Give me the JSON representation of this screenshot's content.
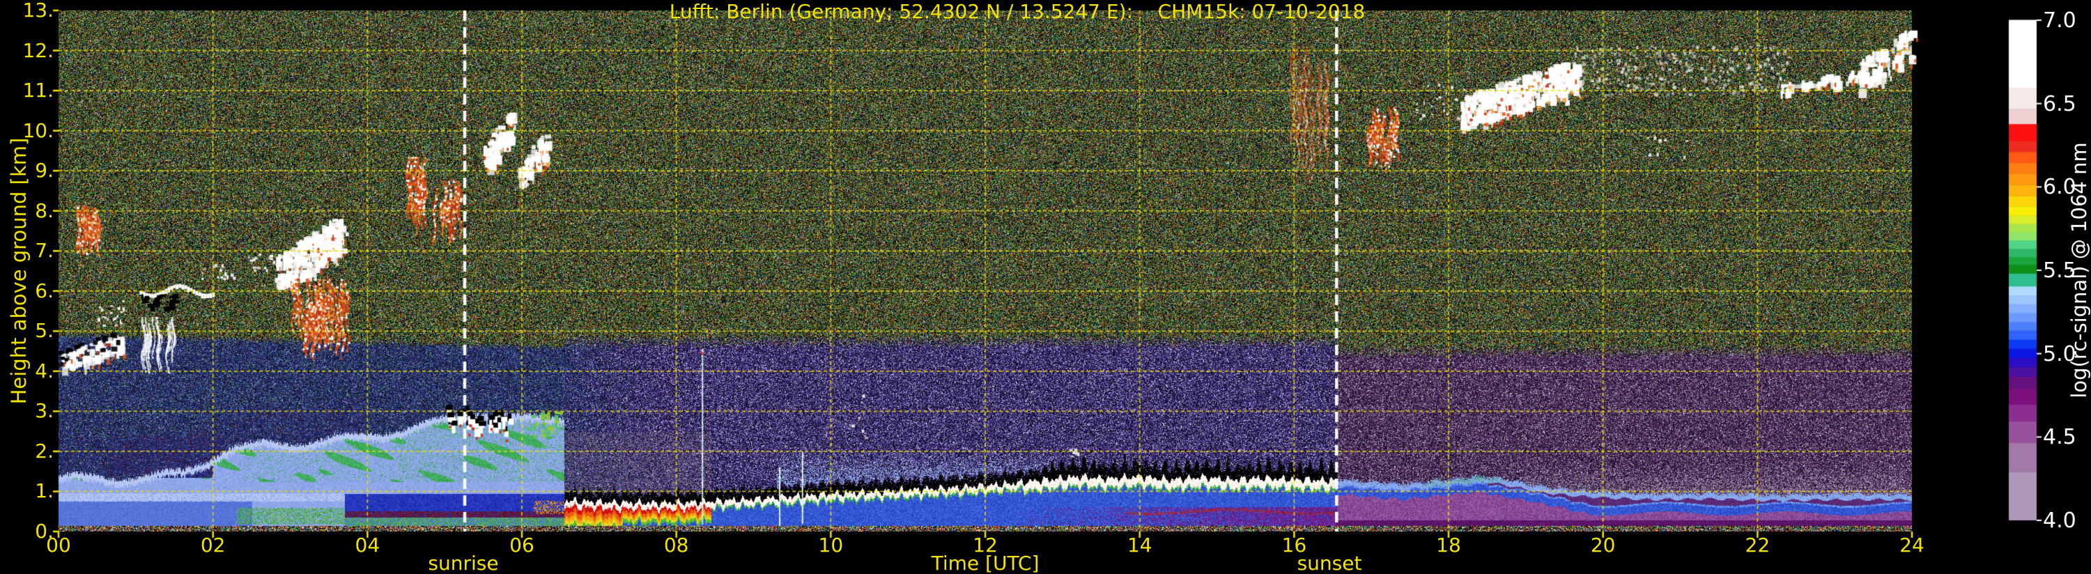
{
  "title": "Lufft: Berlin (Germany; 52.4302 N / 13.5247 E):    CHM15k: 07-10-2018",
  "chart_data": {
    "type": "heatmap",
    "title": "Lufft: Berlin (Germany; 52.4302 N / 13.5247 E):    CHM15k: 07-10-2018",
    "xlabel": "Time [UTC]",
    "ylabel": "Height above ground [km]",
    "x_range": [
      0,
      24
    ],
    "y_range": [
      0,
      13
    ],
    "value_range": [
      4.0,
      7.0
    ],
    "x_ticks": [
      "00",
      "02",
      "04",
      "06",
      "08",
      "10",
      "12",
      "14",
      "16",
      "18",
      "20",
      "22",
      "24"
    ],
    "y_ticks": [
      "0.",
      "1.",
      "2.",
      "3.",
      "4.",
      "5.",
      "6.",
      "7.",
      "8.",
      "9.",
      "10.",
      "11.",
      "12.",
      "13."
    ],
    "grid": {
      "on": true,
      "color": "#f0de00",
      "x_step_hours": 2,
      "y_step_km": 1
    },
    "axis_color": "#f2e400",
    "sunrise_label": "sunrise",
    "sunset_label": "sunset",
    "sunrise_t": 5.26,
    "sunset_t": 16.55,
    "transition_t": 6.55,
    "night_cap_top": [
      4.9,
      4.6
    ],
    "colorbar": {
      "label": "log(rc-signal) @ 1064 nm",
      "ticks": [
        "4.0",
        "4.5",
        "5.0",
        "5.5",
        "6.0",
        "6.5",
        "7.0"
      ],
      "tick_values": [
        4.0,
        4.5,
        5.0,
        5.5,
        6.0,
        6.5,
        7.0
      ],
      "segments": [
        [
          "#ae97b7",
          74
        ],
        [
          "#a279a7",
          45
        ],
        [
          "#98519c",
          33
        ],
        [
          "#8d2d90",
          26
        ],
        [
          "#7c0f7e",
          25
        ],
        [
          "#65107f",
          18
        ],
        [
          "#4a10a0",
          15
        ],
        [
          "#2b0cc4",
          14
        ],
        [
          "#0c17e6",
          14
        ],
        [
          "#0b3bf3",
          14
        ],
        [
          "#2f63fa",
          14
        ],
        [
          "#4c80fb",
          13
        ],
        [
          "#6c9afc",
          14
        ],
        [
          "#86affd",
          14
        ],
        [
          "#9dc5fe",
          13
        ],
        [
          "#afdafe",
          14
        ],
        [
          "#2ebd8e",
          20
        ],
        [
          "#0e8f15",
          13
        ],
        [
          "#17a53c",
          12
        ],
        [
          "#2eb868",
          13
        ],
        [
          "#52d488",
          13
        ],
        [
          "#8fe46a",
          12
        ],
        [
          "#a8e84c",
          13
        ],
        [
          "#d8ee2a",
          13
        ],
        [
          "#f8ef07",
          14
        ],
        [
          "#fdd60a",
          16
        ],
        [
          "#fdb50d",
          17
        ],
        [
          "#fd9a10",
          17
        ],
        [
          "#fd7e12",
          17
        ],
        [
          "#fc5a15",
          17
        ],
        [
          "#ee2b20",
          17
        ],
        [
          "#fb0f0f",
          26
        ],
        [
          "#eed0d0",
          23
        ],
        [
          "#f5e9e9",
          33
        ],
        [
          "#ffffff",
          104
        ]
      ]
    },
    "bl_path": [
      [
        6.55,
        0.78
      ],
      [
        7.2,
        0.73
      ],
      [
        8,
        0.72
      ],
      [
        8.6,
        0.78
      ],
      [
        9.2,
        0.84
      ],
      [
        10,
        0.95
      ],
      [
        10.8,
        1.02
      ],
      [
        11.6,
        1.1
      ],
      [
        12.2,
        1.18
      ],
      [
        12.8,
        1.3
      ],
      [
        13.2,
        1.38
      ],
      [
        13.6,
        1.33
      ],
      [
        14,
        1.38
      ],
      [
        14.4,
        1.3
      ],
      [
        14.8,
        1.36
      ],
      [
        15.2,
        1.3
      ],
      [
        15.6,
        1.34
      ],
      [
        16,
        1.31
      ],
      [
        16.55,
        1.28
      ]
    ],
    "evening_path": [
      [
        16.55,
        1.28
      ],
      [
        17,
        1.2
      ],
      [
        17.4,
        1.15
      ],
      [
        17.8,
        1.22
      ],
      [
        18.2,
        1.3
      ],
      [
        18.5,
        1.34
      ],
      [
        18.8,
        1.24
      ],
      [
        19.2,
        1.08
      ],
      [
        19.6,
        1.0
      ],
      [
        20,
        0.95
      ],
      [
        20.6,
        0.9
      ],
      [
        21.4,
        0.92
      ],
      [
        22.2,
        0.88
      ],
      [
        23,
        0.9
      ],
      [
        24,
        0.9
      ]
    ],
    "night_top_path": [
      [
        0,
        1.4
      ],
      [
        0.8,
        1.35
      ],
      [
        1.6,
        1.5
      ],
      [
        2.2,
        2.1
      ],
      [
        2.6,
        2.2
      ],
      [
        3.2,
        2.25
      ],
      [
        4,
        2.45
      ],
      [
        4.6,
        2.6
      ],
      [
        5,
        2.85
      ],
      [
        5.4,
        3.0
      ],
      [
        5.9,
        2.85
      ],
      [
        6.3,
        2.9
      ],
      [
        6.55,
        2.9
      ]
    ],
    "clouds": [
      [
        0.23,
        0.52,
        6.9,
        8.15,
        "orange",
        50
      ],
      [
        0.03,
        0.78,
        4.1,
        4.9,
        "mixedwhite",
        70
      ],
      [
        0.5,
        0.95,
        5.15,
        5.8,
        "whitedots",
        22
      ],
      [
        1.05,
        2.0,
        5.9,
        6.2,
        "whiteband",
        0
      ],
      [
        1.05,
        1.5,
        5.6,
        5.95,
        "black",
        26
      ],
      [
        1.08,
        1.5,
        3.95,
        5.35,
        "whitestreaks",
        26
      ],
      [
        1.78,
        2.28,
        6.3,
        6.7,
        "whitedots",
        20
      ],
      [
        2.42,
        2.82,
        6.5,
        7.0,
        "whitedots",
        16
      ],
      [
        2.8,
        3.65,
        5.95,
        7.8,
        "bigwhite",
        200
      ],
      [
        2.95,
        3.75,
        4.3,
        6.3,
        "orange",
        70
      ],
      [
        4.5,
        4.75,
        7.35,
        9.35,
        "orange",
        26
      ],
      [
        4.85,
        5.2,
        7.15,
        8.75,
        "orange",
        30
      ],
      [
        5.5,
        5.85,
        8.9,
        10.45,
        "mixed",
        60
      ],
      [
        5.95,
        6.3,
        8.6,
        9.9,
        "mixed",
        55
      ],
      [
        4.95,
        5.85,
        2.0,
        3.1,
        "cumulus",
        26
      ],
      [
        6.05,
        6.5,
        2.35,
        3.0,
        "greendots",
        40
      ],
      [
        8.3,
        8.36,
        0.2,
        4.55,
        "spike",
        0
      ],
      [
        9.3,
        9.36,
        0.2,
        1.6,
        "spike",
        0
      ],
      [
        9.6,
        9.65,
        0.2,
        2.0,
        "spike",
        0
      ],
      [
        13.05,
        13.2,
        1.85,
        2.1,
        "whitedots",
        6
      ],
      [
        10.25,
        10.45,
        2.1,
        3.5,
        "whitedots",
        5
      ],
      [
        15.95,
        16.45,
        8.6,
        12.1,
        "faintorange",
        30
      ],
      [
        16.95,
        17.35,
        9.0,
        10.6,
        "orange",
        36
      ],
      [
        17.5,
        18.3,
        10.3,
        11.2,
        "whitedots",
        26
      ],
      [
        18.15,
        19.65,
        10.1,
        11.7,
        "bigwhite",
        330
      ],
      [
        19.6,
        22.4,
        10.9,
        12.15,
        "hazewhite",
        320
      ],
      [
        20.55,
        21.1,
        9.3,
        9.95,
        "whitedots",
        8
      ],
      [
        22.3,
        23.3,
        10.95,
        11.5,
        "mixed",
        40
      ],
      [
        23.3,
        24.0,
        11.0,
        12.5,
        "bigwhite",
        90
      ]
    ],
    "palettes": {
      "upper": [
        "#000000",
        "#000000",
        "#000000",
        "#060d06",
        "#0f3511",
        "#1e5a21",
        "#318232",
        "#47a546",
        "#7b841f",
        "#aaa42c",
        "#a23418",
        "#c06522",
        "#2c3c8e",
        "#1f285a",
        "#d0d1c2",
        "#3f917c",
        "#641f18",
        "#274115",
        "#8a8a30",
        "#101808"
      ],
      "navy": [
        "#0b1030",
        "#151f4c",
        "#1f2d68",
        "#293b84",
        "#15163a",
        "#394e9e",
        "#090a1e",
        "#31429a",
        "#232e76",
        "#4a66b4",
        "#111432",
        "#2f6a3a",
        "#461a40",
        "#9aa8c8"
      ],
      "dayNoise": [
        "#0d0822",
        "#1b123c",
        "#291b56",
        "#38276d",
        "#463484",
        "#2d2d60",
        "#56439a",
        "#130b2a",
        "#6956b4",
        "#090612",
        "#8a7cc8",
        "#d8d4ea"
      ],
      "eveNoise": [
        "#160a20",
        "#271236",
        "#381b4a",
        "#49275c",
        "#5a356c",
        "#3b294c",
        "#6c497c",
        "#130820",
        "#896e93",
        "#d4c9da",
        "#290e2d",
        "#795988"
      ],
      "ground": [
        "#000000",
        "#000000",
        "#000000",
        "#b82810",
        "#e06414",
        "#ecc41e",
        "#2fa32f",
        "#ffffff",
        "#2a48c8",
        "#18b8a0",
        "#c83c80",
        "#151515"
      ],
      "aeroBase": [
        "#8ea6ea",
        "#96aeee",
        "#86a0e6",
        "#7e98e2",
        "#a0b4f0"
      ],
      "aeroMed": [
        "#5a78de",
        "#5270d8",
        "#6482e2",
        "#4a66d0"
      ],
      "aeroPale": [
        "#b6c6f4",
        "#c2d0f6",
        "#aabef0"
      ],
      "green": [
        "#44b062",
        "#56c070",
        "#2f9a4a",
        "#3aa85e"
      ],
      "greenLow": [
        "#39a35a",
        "#2f9a4a",
        "#44b062",
        "#8cc83e",
        "#42a832"
      ],
      "maroon": [
        "#70162e",
        "#5c1226",
        "#7e1c38",
        "#541020"
      ],
      "darkBlue": [
        "#1e2eb2",
        "#2a3cc8",
        "#1826a0",
        "#3448d4"
      ],
      "blobNavy": [
        "#27307e",
        "#1e2566",
        "#5a1a38",
        "#323c96",
        "#191c52"
      ],
      "speckBlue": [
        "#2a3c9c",
        "#22308a",
        "#324aae",
        "#16204e",
        "#3c54bc",
        "#121836"
      ],
      "blWhite": [
        "#ffffff",
        "#ffffff",
        "#ffffff",
        "#f2ede2",
        "#ffdcc0"
      ],
      "blBlue": [
        "#3054d6",
        "#2a48c4",
        "#3c64e4",
        "#4a72ec",
        "#2440b4"
      ],
      "blGrad": [
        "#d01010",
        "#e85c12",
        "#f2a613",
        "#ead922",
        "#54b83a"
      ],
      "blGreenLine": [
        "#3aa84e",
        "#54c060",
        "#2f9a3f"
      ],
      "magenta": [
        "#6a1678",
        "#7c1c8c",
        "#5a1264",
        "#8a24a0"
      ],
      "eveTop": [
        "#86a8ec",
        "#9ab8f4",
        "#6e94e4"
      ],
      "eveBlue": [
        "#2a4ed0",
        "#3a5ede",
        "#2240b8",
        "#4a6ee8"
      ],
      "evePink": [
        "#8a4898",
        "#7a3c8c",
        "#9a5aa4",
        "#6e2f80",
        "#a06aac"
      ],
      "evePurple": [
        "#5a1468",
        "#4c1058",
        "#6a1c78"
      ],
      "evePurpleMid": [
        "#5c2a78",
        "#4e2268",
        "#6a3488"
      ],
      "grayMauve": [
        "#6a5a78",
        "#7d6c88",
        "#55486a"
      ],
      "grayHaze": [
        "#9a88a4",
        "#8a7894",
        "#a898b0"
      ],
      "hazeBlue": [
        "#8fb0ee",
        "#7a9ce4",
        "#a8c4f4"
      ],
      "redline": [
        "#a02020",
        "#b82828"
      ],
      "cloudOrange": [
        "#e05818",
        "#c03010",
        "#f0a040",
        "#ffffff",
        "#d04818"
      ],
      "spikeCol": [
        "#eef8ff",
        "#b8ecd8",
        "#ffffff",
        "#cfe8ff"
      ]
    }
  }
}
